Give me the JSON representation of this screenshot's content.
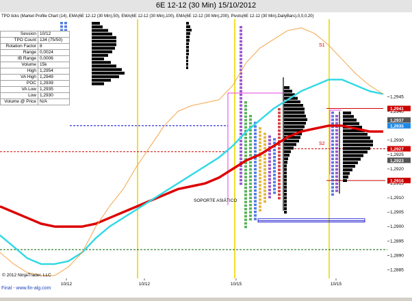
{
  "window": {
    "title": "6E 12-12 (30 Min)  15/10/2012"
  },
  "header": {
    "indicator_line": "TPO ticks (Market Profile Chart (14), EMA(6E 12-12 (30 Min),50), EMA(6E 12-12 (30 Min),100), EMA(6E 12-12 (30 Min),200), Pivots(6E 12-12 (30 Min),DailyBars),0,0,0,20)"
  },
  "info_panel": {
    "rows": [
      {
        "label": "Session",
        "value": "10/12"
      },
      {
        "label": "TPO Count",
        "value": "134 (75/50)"
      },
      {
        "label": "Rotation Factor",
        "value": "8"
      },
      {
        "label": "Range",
        "value": "0,0024"
      },
      {
        "label": "IB Range",
        "value": "0,0006"
      },
      {
        "label": "Volume",
        "value": "15k"
      },
      {
        "label": "High",
        "value": "1,2954"
      },
      {
        "label": "VA High",
        "value": "1,2949"
      },
      {
        "label": "POC",
        "value": "1,2939"
      },
      {
        "label": "VA Low",
        "value": "1,2935"
      },
      {
        "label": "Low",
        "value": "1,2930"
      },
      {
        "label": "Volume @ Price",
        "value": "N/A"
      }
    ]
  },
  "footer": {
    "copyright": "© 2012 NinjaTrader, LLC",
    "link": "Final - www.fin-alg.com"
  },
  "annotations": {
    "soporte": "SOPORTE ASIÁTICO",
    "s1": "S1",
    "s2": "S2"
  },
  "colors": {
    "ema_red": "#dd0000",
    "ema_cyan": "#33d9e6",
    "ema_orange": "#f4a44a",
    "dashed_red": "#cc0000",
    "dashed_blue": "#0000cc",
    "dashed_green": "#006400",
    "vertical_yellow": "#f0e030",
    "histogram": "#000000",
    "price_tag_red": "#cc0000",
    "price_tag_blue": "#1e88e5",
    "price_tag_gray": "#555555"
  },
  "chart_data": {
    "type": "line",
    "title": "6E 12-12 (30 Min)  15/10/2012",
    "xlabel": "",
    "ylabel": "",
    "x_ticks": [
      "10/12",
      "10/12",
      "10/15",
      "10/15"
    ],
    "ylim": [
      1.2882,
      1.2972
    ],
    "y_ticks": [
      "1,2945",
      "1,2940",
      "1,2935",
      "1,2930",
      "1,2925",
      "1,2920",
      "1,2915",
      "1,2910",
      "1,2905",
      "1,2900",
      "1,2895",
      "1,2890",
      "1,2885"
    ],
    "y_tick_values": [
      1.2945,
      1.294,
      1.2935,
      1.293,
      1.2925,
      1.292,
      1.2915,
      1.291,
      1.2905,
      1.29,
      1.2895,
      1.289,
      1.2885
    ],
    "price_tags": [
      {
        "label": "1,2941",
        "value": 1.2941,
        "color": "red"
      },
      {
        "label": "1,2937",
        "value": 1.2937,
        "color": "gray"
      },
      {
        "label": "1,2927",
        "value": 1.2927,
        "color": "red"
      },
      {
        "label": "1,2923",
        "value": 1.2923,
        "color": "gray"
      },
      {
        "label": "1,2916",
        "value": 1.2916,
        "color": "red"
      }
    ],
    "price_tags_blue": [
      {
        "label": "1,2935",
        "value": 1.2935,
        "color": "blue"
      }
    ],
    "reference_lines": [
      {
        "name": "prev-high",
        "value": 1.2926,
        "color": "red",
        "style": "dashed"
      },
      {
        "name": "prev-value-area",
        "value": 1.2935,
        "color": "blue",
        "style": "dashed"
      },
      {
        "name": "soporte-asiatico",
        "value": 1.2902,
        "color": "blue",
        "style": "solid"
      },
      {
        "name": "lower-support",
        "value": 1.2892,
        "color": "green",
        "style": "dashed"
      },
      {
        "name": "s1",
        "value": 1.2941,
        "color": "red",
        "style": "solid"
      },
      {
        "name": "s2",
        "value": 1.2916,
        "color": "red",
        "style": "solid"
      },
      {
        "name": "pivot-upper",
        "value": 1.2927,
        "color": "red",
        "style": "dashed"
      }
    ],
    "series": [
      {
        "name": "EMA 200",
        "color": "red",
        "x": [
          0,
          20,
          40,
          60,
          80,
          100,
          120,
          140,
          160,
          180,
          200,
          220,
          240,
          260,
          280,
          300,
          320,
          340,
          360,
          380,
          400,
          420,
          440,
          460,
          480,
          500,
          520,
          540,
          560
        ],
        "values": [
          1.2907,
          1.2905,
          1.2903,
          1.2901,
          1.29,
          1.29,
          1.29,
          1.2901,
          1.2903,
          1.2905,
          1.2907,
          1.2909,
          1.2911,
          1.2913,
          1.2914,
          1.2915,
          1.2917,
          1.292,
          1.2923,
          1.2925,
          1.2928,
          1.2931,
          1.2933,
          1.2934,
          1.2935,
          1.2935,
          1.2934,
          1.2933,
          1.2933
        ]
      },
      {
        "name": "EMA 100",
        "color": "cyan",
        "x": [
          0,
          20,
          40,
          60,
          80,
          100,
          120,
          140,
          160,
          180,
          200,
          220,
          240,
          260,
          280,
          300,
          320,
          340,
          360,
          380,
          400,
          420,
          440,
          460,
          480,
          500,
          520,
          540,
          560
        ],
        "values": [
          1.2897,
          1.2893,
          1.2889,
          1.2887,
          1.2887,
          1.2888,
          1.2891,
          1.2896,
          1.29,
          1.2903,
          1.2906,
          1.2909,
          1.2912,
          1.2915,
          1.2918,
          1.2921,
          1.2924,
          1.2928,
          1.2933,
          1.2937,
          1.2941,
          1.2944,
          1.2947,
          1.2949,
          1.2951,
          1.2951,
          1.2949,
          1.2947,
          1.2946
        ]
      },
      {
        "name": "EMA 50",
        "color": "orange",
        "x": [
          0,
          20,
          40,
          60,
          80,
          100,
          120,
          140,
          160,
          180,
          200,
          220,
          240,
          260,
          280,
          300,
          320,
          340,
          360,
          380,
          400,
          420,
          440,
          460,
          480,
          500,
          520,
          540,
          560
        ],
        "values": [
          1.2891,
          1.2887,
          1.2884,
          1.2883,
          1.2883,
          1.2886,
          1.2891,
          1.29,
          1.2907,
          1.2913,
          1.2921,
          1.2928,
          1.2935,
          1.294,
          1.2942,
          1.2943,
          1.2944,
          1.2949,
          1.2957,
          1.2962,
          1.2965,
          1.2968,
          1.2969,
          1.2967,
          1.2963,
          1.2958,
          1.2953,
          1.2949,
          1.2946
        ]
      }
    ],
    "profiles": [
      {
        "name": "profile-10-12-a",
        "letters_x_col": "left",
        "rows": [
          {
            "price": 1.2967,
            "letters": "",
            "len": 10
          },
          {
            "price": 1.2965,
            "letters": "",
            "len": 15
          },
          {
            "price": 1.2963,
            "letters": "",
            "len": 20
          },
          {
            "price": 1.2961,
            "letters": "",
            "len": 27
          },
          {
            "price": 1.2959,
            "letters": "",
            "len": 33
          },
          {
            "price": 1.2957,
            "letters": "",
            "len": 33
          },
          {
            "price": 1.2955,
            "letters": "",
            "len": 33
          },
          {
            "price": 1.2953,
            "letters": "",
            "len": 30
          },
          {
            "price": 1.2951,
            "letters": "",
            "len": 27
          },
          {
            "price": 1.2949,
            "letters": "",
            "len": 20
          },
          {
            "price": 1.2947,
            "letters": "",
            "len": 15
          },
          {
            "price": 1.2945,
            "letters": "",
            "len": 30
          },
          {
            "price": 1.2943,
            "letters": "",
            "len": 40
          },
          {
            "price": 1.2941,
            "letters": "",
            "len": 45
          },
          {
            "price": 1.2939,
            "letters": "",
            "len": 48
          },
          {
            "price": 1.2937,
            "letters": "",
            "len": 40
          },
          {
            "price": 1.2935,
            "letters": "",
            "len": 25
          }
        ]
      }
    ]
  }
}
